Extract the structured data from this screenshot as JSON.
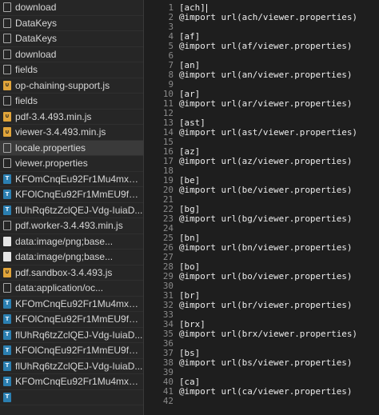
{
  "files": [
    {
      "name": "download",
      "icon": "doc"
    },
    {
      "name": "DataKeys",
      "icon": "doc"
    },
    {
      "name": "DataKeys",
      "icon": "doc"
    },
    {
      "name": "download",
      "icon": "doc"
    },
    {
      "name": "fields",
      "icon": "doc"
    },
    {
      "name": "op-chaining-support.js",
      "icon": "js"
    },
    {
      "name": "fields",
      "icon": "doc"
    },
    {
      "name": "pdf-3.4.493.min.js",
      "icon": "js"
    },
    {
      "name": "viewer-3.4.493.min.js",
      "icon": "js"
    },
    {
      "name": "locale.properties",
      "icon": "doc",
      "selected": true
    },
    {
      "name": "viewer.properties",
      "icon": "doc"
    },
    {
      "name": "KFOmCnqEu92Fr1Mu4mxK...",
      "icon": "font"
    },
    {
      "name": "KFOlCnqEu92Fr1MmEU9fB...",
      "icon": "font"
    },
    {
      "name": "flUhRq6tzZclQEJ-Vdg-IuiaD...",
      "icon": "font"
    },
    {
      "name": "pdf.worker-3.4.493.min.js",
      "icon": "doc"
    },
    {
      "name": "data:image/png;base...",
      "icon": "img"
    },
    {
      "name": "data:image/png;base...",
      "icon": "img"
    },
    {
      "name": "pdf.sandbox-3.4.493.js",
      "icon": "js"
    },
    {
      "name": "data:application/oc...",
      "icon": "doc"
    },
    {
      "name": "KFOmCnqEu92Fr1Mu4mxK...",
      "icon": "font"
    },
    {
      "name": "KFOlCnqEu92Fr1MmEU9fB...",
      "icon": "font"
    },
    {
      "name": "flUhRq6tzZclQEJ-Vdg-IuiaD...",
      "icon": "font"
    },
    {
      "name": "KFOlCnqEu92Fr1MmEU9fB...",
      "icon": "font"
    },
    {
      "name": "flUhRq6tzZclQEJ-Vdg-IuiaD...",
      "icon": "font"
    },
    {
      "name": "KFOmCnqEu92Fr1Mu4mxK...",
      "icon": "font"
    },
    {
      "name": "",
      "icon": "font"
    }
  ],
  "code": [
    {
      "n": "1",
      "t": "[ach]",
      "cursor": true
    },
    {
      "n": "2",
      "t": "@import url(ach/viewer.properties)"
    },
    {
      "n": "3",
      "t": ""
    },
    {
      "n": "4",
      "t": "[af]"
    },
    {
      "n": "5",
      "t": "@import url(af/viewer.properties)"
    },
    {
      "n": "6",
      "t": ""
    },
    {
      "n": "7",
      "t": "[an]"
    },
    {
      "n": "8",
      "t": "@import url(an/viewer.properties)"
    },
    {
      "n": "9",
      "t": ""
    },
    {
      "n": "10",
      "t": "[ar]"
    },
    {
      "n": "11",
      "t": "@import url(ar/viewer.properties)"
    },
    {
      "n": "12",
      "t": ""
    },
    {
      "n": "13",
      "t": "[ast]"
    },
    {
      "n": "14",
      "t": "@import url(ast/viewer.properties)"
    },
    {
      "n": "15",
      "t": ""
    },
    {
      "n": "16",
      "t": "[az]"
    },
    {
      "n": "17",
      "t": "@import url(az/viewer.properties)"
    },
    {
      "n": "18",
      "t": ""
    },
    {
      "n": "19",
      "t": "[be]"
    },
    {
      "n": "20",
      "t": "@import url(be/viewer.properties)"
    },
    {
      "n": "21",
      "t": ""
    },
    {
      "n": "22",
      "t": "[bg]"
    },
    {
      "n": "23",
      "t": "@import url(bg/viewer.properties)"
    },
    {
      "n": "24",
      "t": ""
    },
    {
      "n": "25",
      "t": "[bn]"
    },
    {
      "n": "26",
      "t": "@import url(bn/viewer.properties)"
    },
    {
      "n": "27",
      "t": ""
    },
    {
      "n": "28",
      "t": "[bo]"
    },
    {
      "n": "29",
      "t": "@import url(bo/viewer.properties)"
    },
    {
      "n": "30",
      "t": ""
    },
    {
      "n": "31",
      "t": "[br]"
    },
    {
      "n": "32",
      "t": "@import url(br/viewer.properties)"
    },
    {
      "n": "33",
      "t": ""
    },
    {
      "n": "34",
      "t": "[brx]"
    },
    {
      "n": "35",
      "t": "@import url(brx/viewer.properties)"
    },
    {
      "n": "36",
      "t": ""
    },
    {
      "n": "37",
      "t": "[bs]"
    },
    {
      "n": "38",
      "t": "@import url(bs/viewer.properties)"
    },
    {
      "n": "39",
      "t": ""
    },
    {
      "n": "40",
      "t": "[ca]"
    },
    {
      "n": "41",
      "t": "@import url(ca/viewer.properties)"
    },
    {
      "n": "42",
      "t": ""
    }
  ]
}
